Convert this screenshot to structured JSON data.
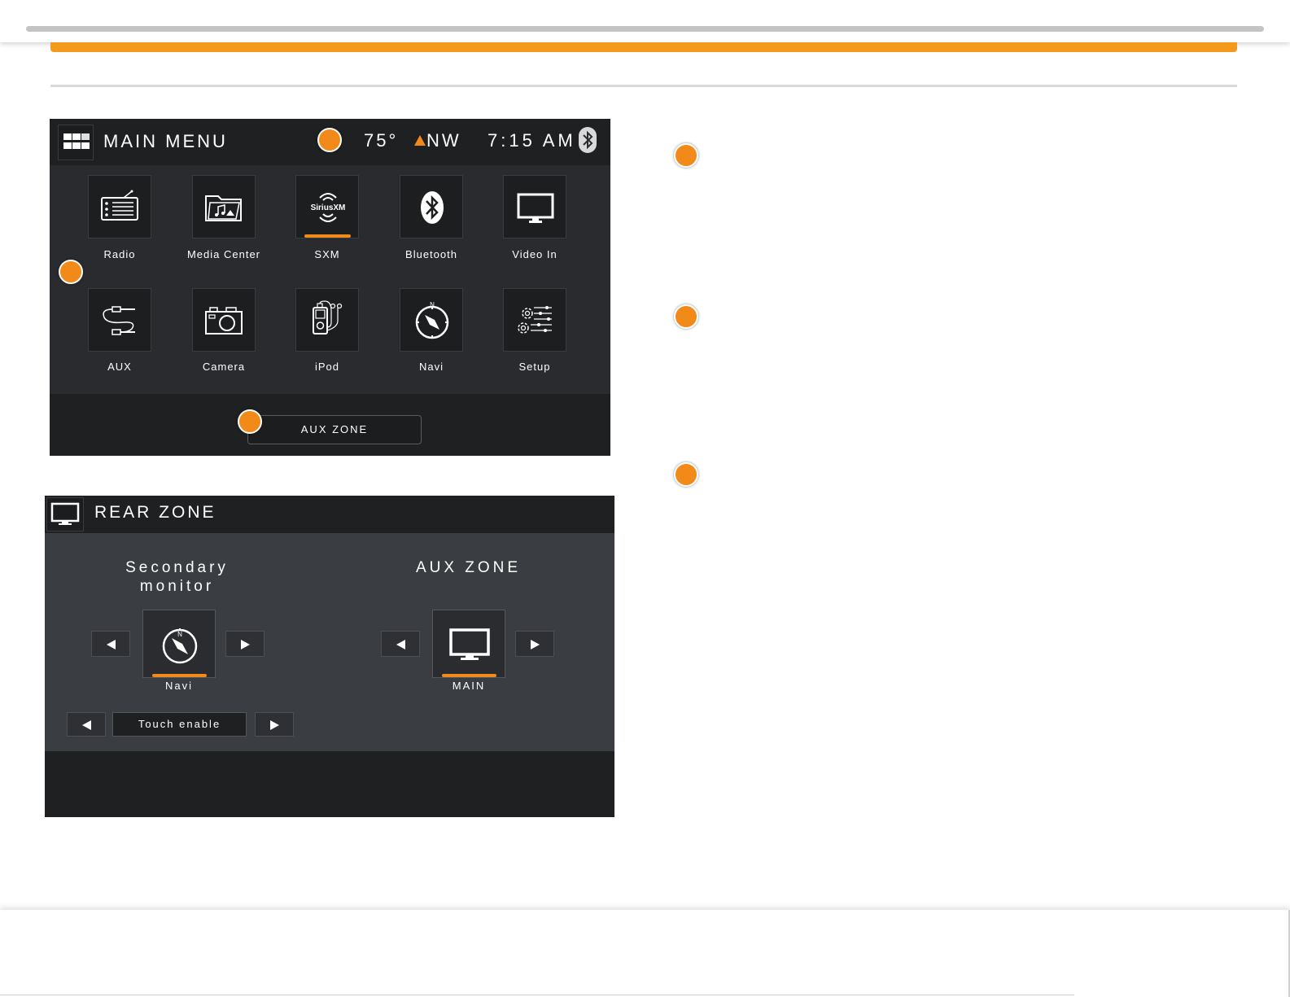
{
  "colors": {
    "accent": "#f28a1a",
    "orange_bar": "#f39a1e",
    "screen_bg": "#2a2b2e",
    "header_bg": "#1f2022",
    "rear_bg": "#3a3d42"
  },
  "main_menu": {
    "title": "MAIN MENU",
    "temperature": "75°",
    "direction": "NW",
    "time": "7:15 AM",
    "tiles": [
      {
        "label": "Radio",
        "icon": "radio-icon"
      },
      {
        "label": "Media Center",
        "icon": "folder-media-icon"
      },
      {
        "label": "SXM",
        "icon": "siriusxm-icon",
        "active": true,
        "logo_text": "SiriusXM"
      },
      {
        "label": "Bluetooth",
        "icon": "bluetooth-icon"
      },
      {
        "label": "Video In",
        "icon": "monitor-icon"
      },
      {
        "label": "AUX",
        "icon": "aux-cable-icon"
      },
      {
        "label": "Camera",
        "icon": "camera-icon"
      },
      {
        "label": "iPod",
        "icon": "ipod-icon"
      },
      {
        "label": "Navi",
        "icon": "compass-icon"
      },
      {
        "label": "Setup",
        "icon": "settings-sliders-icon"
      }
    ],
    "aux_zone_button": "AUX ZONE"
  },
  "rear_zone": {
    "title": "REAR ZONE",
    "secondary_heading_line1": "Secondary",
    "secondary_heading_line2": "monitor",
    "secondary_source": "Navi",
    "aux_heading": "AUX ZONE",
    "aux_source": "MAIN",
    "touch_label": "Touch enable"
  }
}
